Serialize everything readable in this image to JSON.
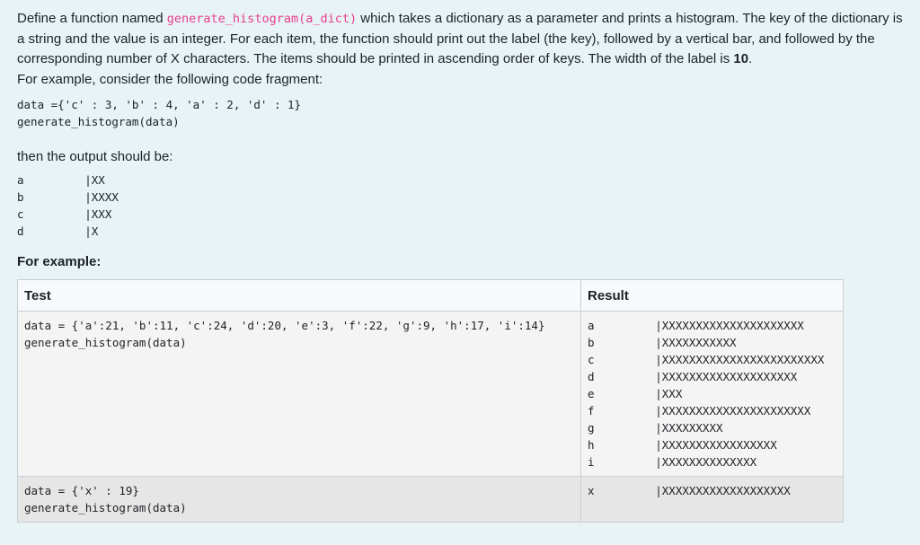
{
  "question": {
    "text_before": "Define a function named ",
    "func_name": "generate_histogram(a_dict)",
    "text_after": " which takes a dictionary as a parameter and prints a histogram. The key of the dictionary is a string and the value is an integer. For each item, the function should print out the label (the key), followed by a vertical bar, and followed by the corresponding number of X characters. The items should be printed in ascending order of keys. The width of the label is ",
    "width_value": "10",
    "text_end": ".",
    "example_intro": "For example, consider the following code fragment:",
    "code": "data ={'c' : 3, 'b' : 4, 'a' : 2, 'd' : 1}\ngenerate_histogram(data)",
    "then_text": "then the output should be:",
    "output": "a         |XX\nb         |XXXX\nc         |XXX\nd         |X"
  },
  "examples": {
    "heading": "For example:",
    "headers": [
      "Test",
      "Result"
    ],
    "rows": [
      {
        "test": "data = {'a':21, 'b':11, 'c':24, 'd':20, 'e':3, 'f':22, 'g':9, 'h':17, 'i':14}\ngenerate_histogram(data)",
        "result": "a         |XXXXXXXXXXXXXXXXXXXXX\nb         |XXXXXXXXXXX\nc         |XXXXXXXXXXXXXXXXXXXXXXXX\nd         |XXXXXXXXXXXXXXXXXXXX\ne         |XXX\nf         |XXXXXXXXXXXXXXXXXXXXXX\ng         |XXXXXXXXX\nh         |XXXXXXXXXXXXXXXXX\ni         |XXXXXXXXXXXXXX"
      },
      {
        "test": "data = {'x' : 19}\ngenerate_histogram(data)",
        "result": "x         |XXXXXXXXXXXXXXXXXXX"
      }
    ]
  }
}
